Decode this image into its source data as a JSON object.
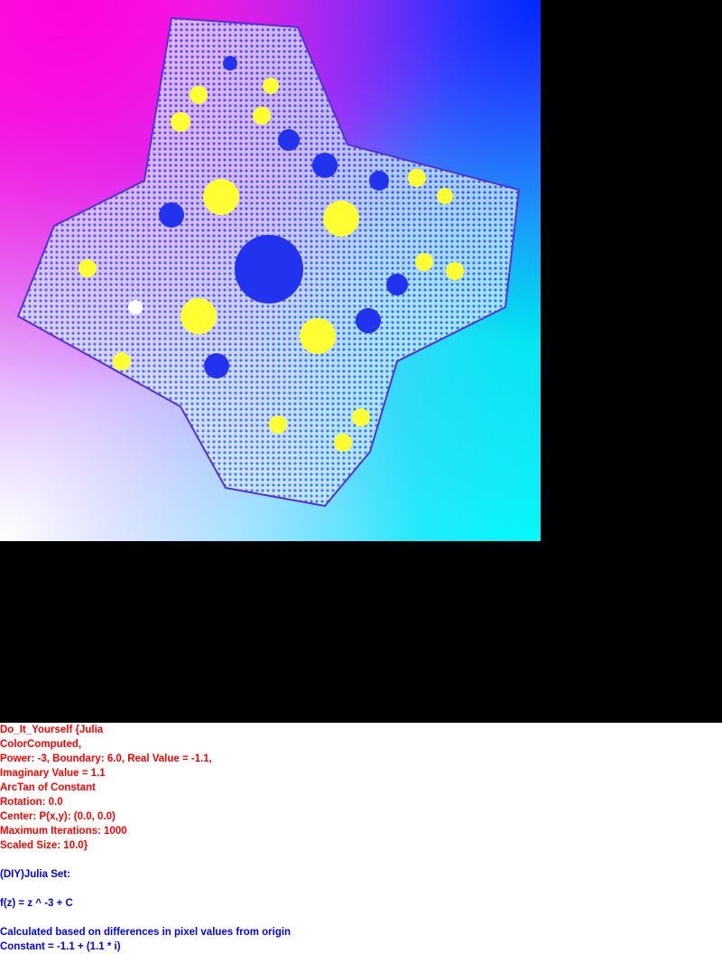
{
  "info": {
    "parameters": [
      "Do_It_Yourself {Julia",
      "ColorComputed,",
      "Power: -3, Boundary: 6.0, Real Value = -1.1,",
      "Imaginary Value = 1.1",
      "ArcTan of Constant",
      "Rotation: 0.0",
      "Center: P(x,y): (0.0, 0.0)",
      "Maximum Iterations: 1000",
      "Scaled Size: 10.0}"
    ],
    "set_title": "(DIY)Julia Set:",
    "formula": "f(z) = z ^ -3 + C",
    "method": "Calculated based on differences in pixel values from origin",
    "constant": "Constant = -1.1 + (1.1 * i)"
  },
  "colors": {
    "background": "#000000",
    "parameter_text": "#ff0000",
    "description_text": "#0000ff",
    "blob_yellow": "#ffff33",
    "blob_blue": "#2233ee"
  }
}
